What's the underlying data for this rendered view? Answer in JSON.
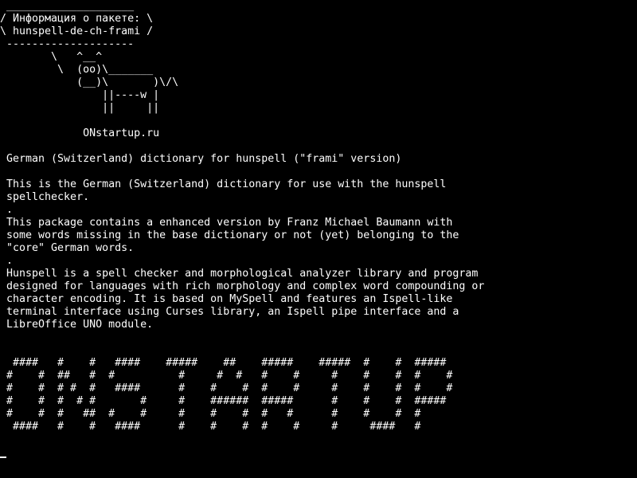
{
  "terminal": {
    "lines": [
      " ____________________",
      "/ Информация о пакете: \\",
      "\\ hunspell-de-ch-frami /",
      " --------------------",
      "        \\   ^__^",
      "         \\  (oo)\\_______",
      "            (__)\\       )\\/\\",
      "                ||----w |",
      "                ||     ||",
      "",
      "             ONstartup.ru",
      "",
      " German (Switzerland) dictionary for hunspell (\"frami\" version)",
      "",
      " This is the German (Switzerland) dictionary for use with the hunspell",
      " spellchecker.",
      " .",
      " This package contains a enhanced version by Franz Michael Baumann with",
      " some words missing in the base dictionary or not (yet) belonging to the",
      " \"core\" German words.",
      " .",
      " Hunspell is a spell checker and morphological analyzer library and program",
      " designed for languages with rich morphology and complex word compounding or",
      " character encoding. It is based on MySpell and features an Ispell-like",
      " terminal interface using Curses library, an Ispell pipe interface and a",
      " LibreOffice UNO module.",
      "",
      "",
      "  ####   #    #   ####    #####    ##    #####    #####  #    #  #####",
      " #    #  ##   #  #          #     #  #   #    #     #    #    #  #    #",
      " #    #  # #  #   ####      #    #    #  #    #     #    #    #  #    #",
      " #    #  #  # #       #     #    ######  #####      #    #    #  #####",
      " #    #  #   ##  #    #     #    #    #  #   #      #    #    #  #",
      "  ####   #    #   ####      #    #    #  #    #     #     ####   #"
    ]
  }
}
